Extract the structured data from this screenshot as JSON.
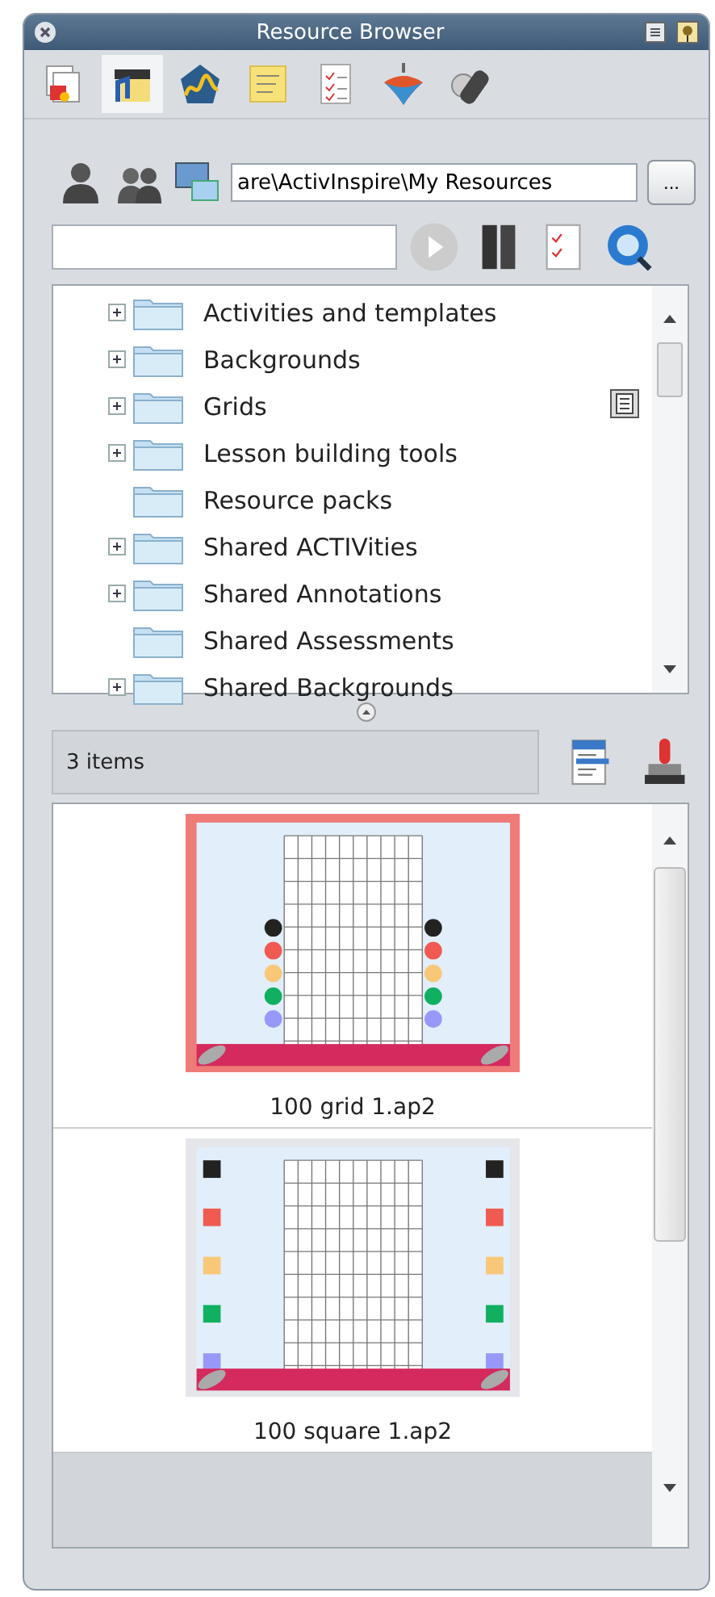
{
  "window": {
    "title": "Resource Browser"
  },
  "tabs": [
    {
      "selected": false
    },
    {
      "selected": true
    },
    {
      "selected": false
    },
    {
      "selected": false
    },
    {
      "selected": false
    },
    {
      "selected": false
    },
    {
      "selected": false
    }
  ],
  "path_field": {
    "value": "are\\ActivInspire\\My Resources"
  },
  "browse_button": "...",
  "tree": [
    {
      "label": "Activities and templates",
      "has_children": true
    },
    {
      "label": "Backgrounds",
      "has_children": true
    },
    {
      "label": "Grids",
      "has_children": true
    },
    {
      "label": "Lesson building tools",
      "has_children": true
    },
    {
      "label": "Resource packs",
      "has_children": false
    },
    {
      "label": "Shared ACTIVities",
      "has_children": true
    },
    {
      "label": "Shared Annotations",
      "has_children": true
    },
    {
      "label": "Shared Assessments",
      "has_children": false
    },
    {
      "label": "Shared Backgrounds",
      "has_children": true
    }
  ],
  "status": "3 items",
  "resources": [
    {
      "name": "100 grid 1.ap2",
      "kind": "dots"
    },
    {
      "name": "100 square 1.ap2",
      "kind": "squares"
    }
  ]
}
